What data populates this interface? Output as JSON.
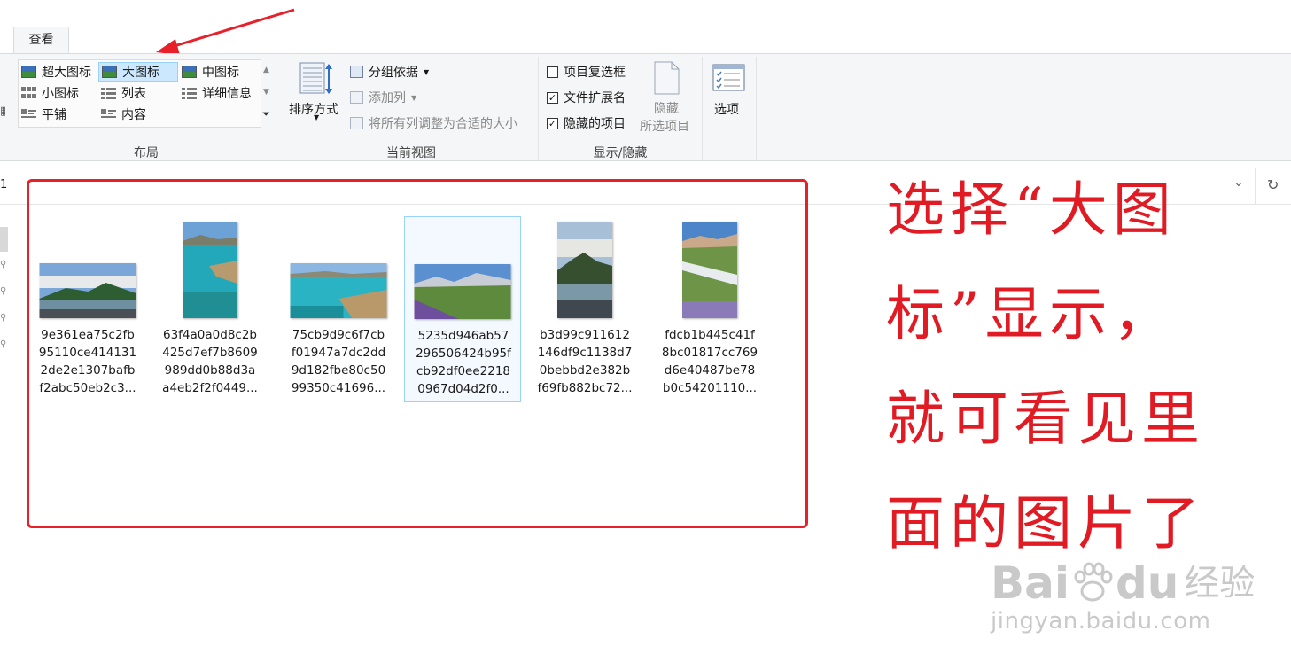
{
  "ribbon": {
    "tab": "查看",
    "layout": {
      "label": "布局",
      "options": [
        "超大图标",
        "大图标",
        "中图标",
        "小图标",
        "列表",
        "详细信息",
        "平铺",
        "内容"
      ],
      "selected": "大图标"
    },
    "current_view": {
      "label": "当前视图",
      "sort": "排序方式",
      "group_by": "分组依据",
      "add_column": "添加列",
      "fit_columns": "将所有列调整为合适的大小"
    },
    "show_hide": {
      "label": "显示/隐藏",
      "item_checkboxes": "项目复选框",
      "file_extensions": "文件扩展名",
      "hidden_items": "隐藏的项目",
      "item_checkboxes_checked": false,
      "file_extensions_checked": true,
      "hidden_items_checked": true,
      "hide_selected": "隐藏",
      "hide_selected_2": "所选项目"
    },
    "options": "选项"
  },
  "address": {
    "left_fragment": "1"
  },
  "files": [
    {
      "name_lines": [
        "9e361ea75c2fb",
        "95110ce414131",
        "2de2e1307bafb",
        "f2abc50eb2c3..."
      ]
    },
    {
      "name_lines": [
        "63f4a0a0d8c2b",
        "425d7ef7b8609",
        "989dd0b88d3a",
        "a4eb2f2f0449..."
      ]
    },
    {
      "name_lines": [
        "75cb9d9c6f7cb",
        "f01947a7dc2dd",
        "9d182fbe80c50",
        "99350c41696..."
      ]
    },
    {
      "name_lines": [
        "5235d946ab57",
        "296506424b95f",
        "cb92df0ee2218",
        "0967d04d2f0..."
      ]
    },
    {
      "name_lines": [
        "b3d99c911612",
        "146df9c1138d7",
        "0bebbd2e382b",
        "f69fb882bc72..."
      ]
    },
    {
      "name_lines": [
        "fdcb1b445c41f",
        "8bc01817cc769",
        "d6e40487be78",
        "b0c54201110..."
      ]
    }
  ],
  "annotation": {
    "lines": [
      "选择“大图",
      "标”显示，",
      "就可看见里",
      "面的图片了"
    ]
  },
  "watermark": {
    "brand": "Bai",
    "brand2": "du",
    "cn": "经验",
    "url": "jingyan.baidu.com"
  },
  "colors": {
    "annotation": "#e01b24",
    "selection": "#cce8ff"
  }
}
